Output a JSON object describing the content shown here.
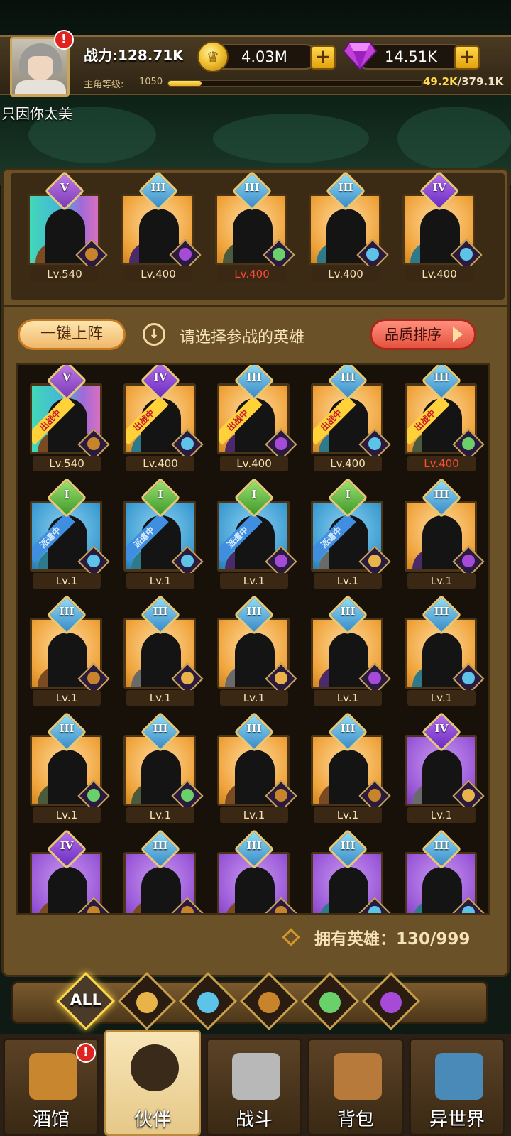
{
  "player": {
    "name": "只因你太美",
    "power": "战力:128.71K",
    "gold": "4.03M",
    "gems": "14.51K",
    "level_label": "主角等级:",
    "level": "1050",
    "xp_current": "49.2K",
    "xp_max": "/379.1K",
    "xp_fraction": 0.13
  },
  "team": [
    {
      "rank": "V",
      "level": "Lv.540",
      "quality": "rainbow",
      "faction": "beast",
      "red": false
    },
    {
      "rank": "III",
      "level": "Lv.400",
      "quality": "gold",
      "faction": "demon",
      "red": false
    },
    {
      "rank": "III",
      "level": "Lv.400",
      "quality": "gold",
      "faction": "elf",
      "red": true
    },
    {
      "rank": "III",
      "level": "Lv.400",
      "quality": "gold",
      "faction": "sea",
      "red": false
    },
    {
      "rank": "IV",
      "level": "Lv.400",
      "quality": "gold",
      "faction": "sea",
      "red": false
    }
  ],
  "controls": {
    "one_click": "一键上阵",
    "hint": "请选择参战的英雄",
    "sort": "品质排序"
  },
  "heroes": [
    {
      "rank": "V",
      "level": "Lv.540",
      "quality": "rainbow",
      "faction": "beast",
      "ribbon": "出战中",
      "red": false
    },
    {
      "rank": "IV",
      "level": "Lv.400",
      "quality": "gold",
      "faction": "sea",
      "ribbon": "出战中",
      "red": false
    },
    {
      "rank": "III",
      "level": "Lv.400",
      "quality": "gold",
      "faction": "demon",
      "ribbon": "出战中",
      "red": false
    },
    {
      "rank": "III",
      "level": "Lv.400",
      "quality": "gold",
      "faction": "sea",
      "ribbon": "出战中",
      "red": false
    },
    {
      "rank": "III",
      "level": "Lv.400",
      "quality": "gold",
      "faction": "elf",
      "ribbon": "出战中",
      "red": true
    },
    {
      "rank": "I",
      "level": "Lv.1",
      "quality": "blue",
      "faction": "sea",
      "ribbon": "派遣中",
      "red": false
    },
    {
      "rank": "I",
      "level": "Lv.1",
      "quality": "blue",
      "faction": "sea",
      "ribbon": "派遣中",
      "red": false
    },
    {
      "rank": "I",
      "level": "Lv.1",
      "quality": "blue",
      "faction": "demon",
      "ribbon": "派遣中",
      "red": false
    },
    {
      "rank": "I",
      "level": "Lv.1",
      "quality": "blue",
      "faction": "human",
      "ribbon": "派遣中",
      "red": false
    },
    {
      "rank": "III",
      "level": "Lv.1",
      "quality": "gold",
      "faction": "demon",
      "ribbon": "",
      "red": false
    },
    {
      "rank": "III",
      "level": "Lv.1",
      "quality": "gold",
      "faction": "beast",
      "ribbon": "",
      "red": false
    },
    {
      "rank": "III",
      "level": "Lv.1",
      "quality": "gold",
      "faction": "human",
      "ribbon": "",
      "red": false
    },
    {
      "rank": "III",
      "level": "Lv.1",
      "quality": "gold",
      "faction": "human",
      "ribbon": "",
      "red": false
    },
    {
      "rank": "III",
      "level": "Lv.1",
      "quality": "gold",
      "faction": "demon",
      "ribbon": "",
      "red": false
    },
    {
      "rank": "III",
      "level": "Lv.1",
      "quality": "gold",
      "faction": "sea",
      "ribbon": "",
      "red": false
    },
    {
      "rank": "III",
      "level": "Lv.1",
      "quality": "gold",
      "faction": "elf",
      "ribbon": "",
      "red": false
    },
    {
      "rank": "III",
      "level": "Lv.1",
      "quality": "gold",
      "faction": "elf",
      "ribbon": "",
      "red": false
    },
    {
      "rank": "III",
      "level": "Lv.1",
      "quality": "gold",
      "faction": "beast",
      "ribbon": "",
      "red": false
    },
    {
      "rank": "III",
      "level": "Lv.1",
      "quality": "gold",
      "faction": "beast",
      "ribbon": "",
      "red": false
    },
    {
      "rank": "IV",
      "level": "Lv.1",
      "quality": "purple",
      "faction": "human",
      "ribbon": "",
      "red": false
    },
    {
      "rank": "IV",
      "level": "",
      "quality": "purple",
      "faction": "beast",
      "ribbon": "",
      "red": false
    },
    {
      "rank": "III",
      "level": "",
      "quality": "purple",
      "faction": "beast",
      "ribbon": "",
      "red": false
    },
    {
      "rank": "III",
      "level": "",
      "quality": "purple",
      "faction": "beast",
      "ribbon": "",
      "red": false
    },
    {
      "rank": "III",
      "level": "",
      "quality": "purple",
      "faction": "sea",
      "ribbon": "",
      "red": false
    },
    {
      "rank": "III",
      "level": "",
      "quality": "purple",
      "faction": "sea",
      "ribbon": "",
      "red": false
    }
  ],
  "owned": "拥有英雄：130/999",
  "filters": [
    {
      "name": "all",
      "label": "ALL",
      "active": true
    },
    {
      "name": "human",
      "label": "",
      "active": false,
      "color": "#e8b44a"
    },
    {
      "name": "sea",
      "label": "",
      "active": false,
      "color": "#5ec3e8"
    },
    {
      "name": "beast",
      "label": "",
      "active": false,
      "color": "#c8842a"
    },
    {
      "name": "elf",
      "label": "",
      "active": false,
      "color": "#6ad06a"
    },
    {
      "name": "demon",
      "label": "",
      "active": false,
      "color": "#a64ad8"
    }
  ],
  "tabs": [
    {
      "name": "tavern",
      "label": "酒馆",
      "active": false,
      "alert": true
    },
    {
      "name": "partner",
      "label": "伙伴",
      "active": true,
      "alert": false
    },
    {
      "name": "battle",
      "label": "战斗",
      "active": false,
      "alert": false
    },
    {
      "name": "bag",
      "label": "背包",
      "active": false,
      "alert": false
    },
    {
      "name": "other-world",
      "label": "异世界",
      "active": false,
      "alert": false
    }
  ],
  "icons": {
    "alert": "!",
    "plus": "+",
    "coin": "crown-coin-icon",
    "gem": "gem-icon",
    "down": "↓"
  }
}
